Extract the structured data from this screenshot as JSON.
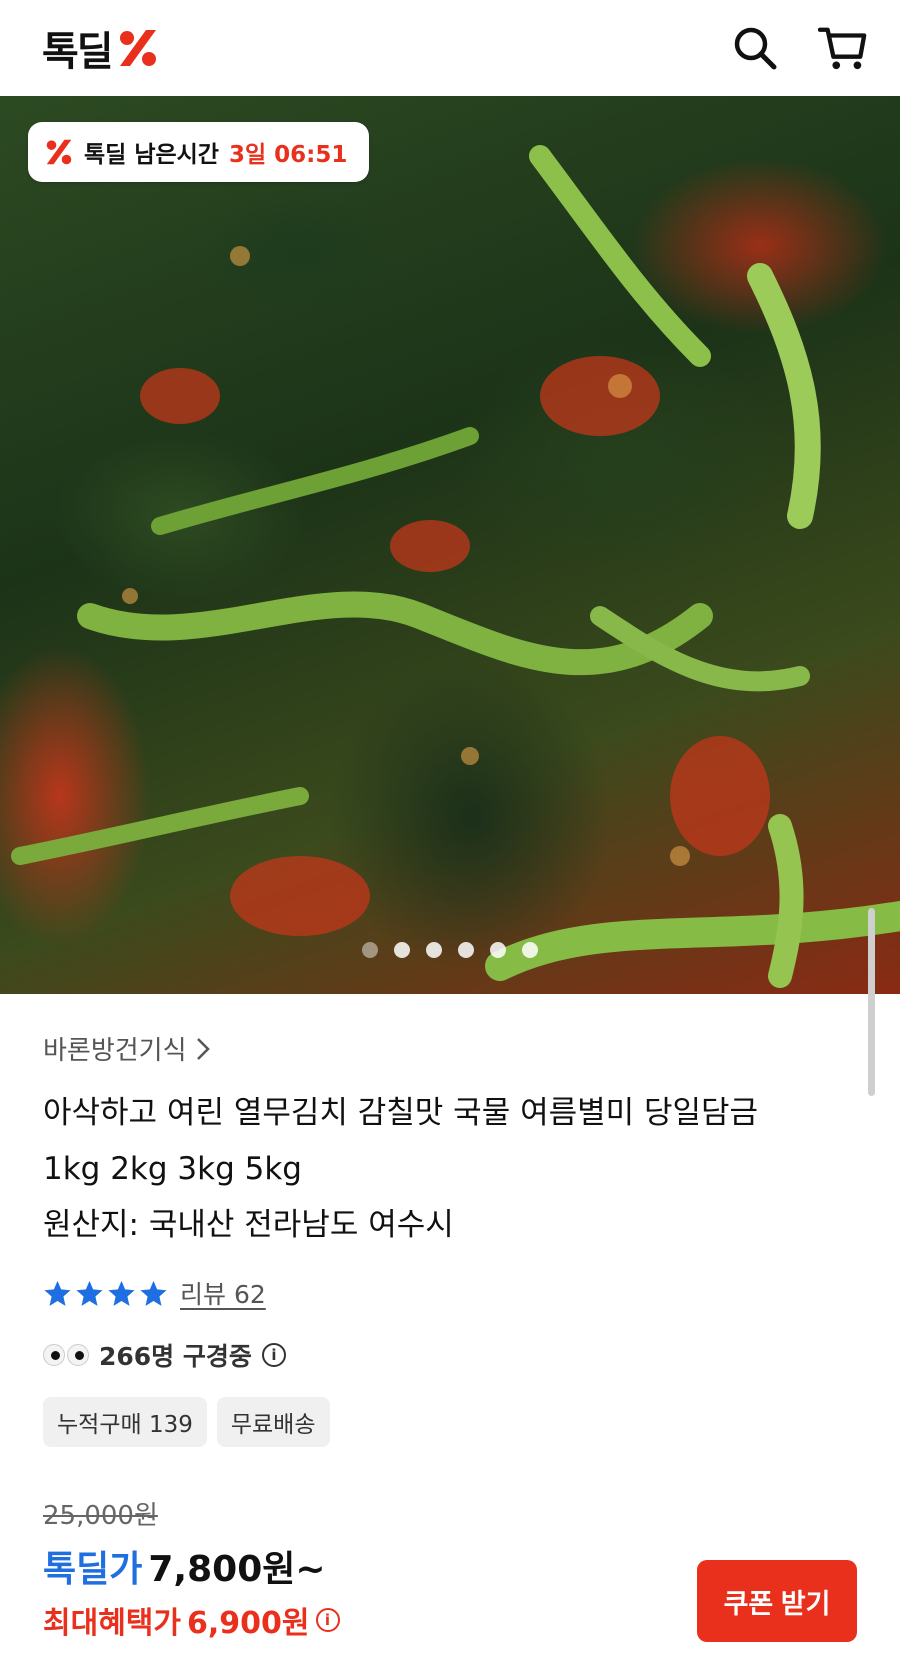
{
  "header": {
    "logo_text": "톡딜",
    "icons": [
      "search-icon",
      "cart-icon"
    ]
  },
  "hero": {
    "timer": {
      "label": "톡딜 남은시간",
      "value": "3일 06:51"
    },
    "carousel": {
      "total": 6,
      "active_index": 0
    }
  },
  "product": {
    "seller": "바론방건기식",
    "title_line1": "아삭하고 여린 열무김치 감칠맛 국물 여름별미 당일담금",
    "title_line2": "1kg 2kg 3kg 5kg",
    "title_line3": "원산지: 국내산 전라남도 여수시",
    "rating": {
      "stars": 4,
      "review_label": "리뷰 62"
    },
    "viewers_text": "266명 구경중",
    "tags": [
      "누적구매 139",
      "무료배송"
    ]
  },
  "price": {
    "original": "25,000원",
    "deal_label": "톡딜가",
    "deal_price": "7,800원~",
    "max_label": "최대혜택가",
    "max_price": "6,900원"
  },
  "actions": {
    "coupon_label": "쿠폰 받기"
  },
  "colors": {
    "brand_red": "#e8301c",
    "star_blue": "#1f6fe0",
    "deal_blue": "#1f6fe0"
  }
}
